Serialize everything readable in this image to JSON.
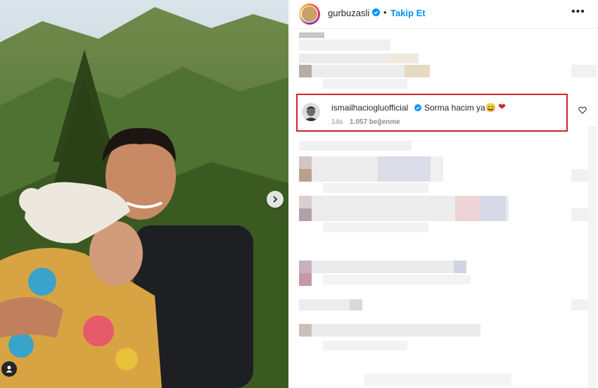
{
  "post": {
    "author": "gurbuzasli",
    "follow_label": "Takip Et",
    "separator": "•"
  },
  "highlighted_comment": {
    "username": "ismailhaciogluofficial",
    "text": "Sorma hacim ya",
    "emoji": "😄",
    "heart": "❤",
    "time": "14s",
    "likes": "1.057 beğenme"
  },
  "icons": {
    "more": "more-options-icon",
    "verified": "verified-badge-icon",
    "next": "chevron-right-icon",
    "tag": "user-tag-icon",
    "like": "heart-outline-icon"
  },
  "colors": {
    "accent": "#0095f6",
    "highlight_border": "#d0242b",
    "text": "#262626",
    "muted": "#8e8e8e"
  }
}
